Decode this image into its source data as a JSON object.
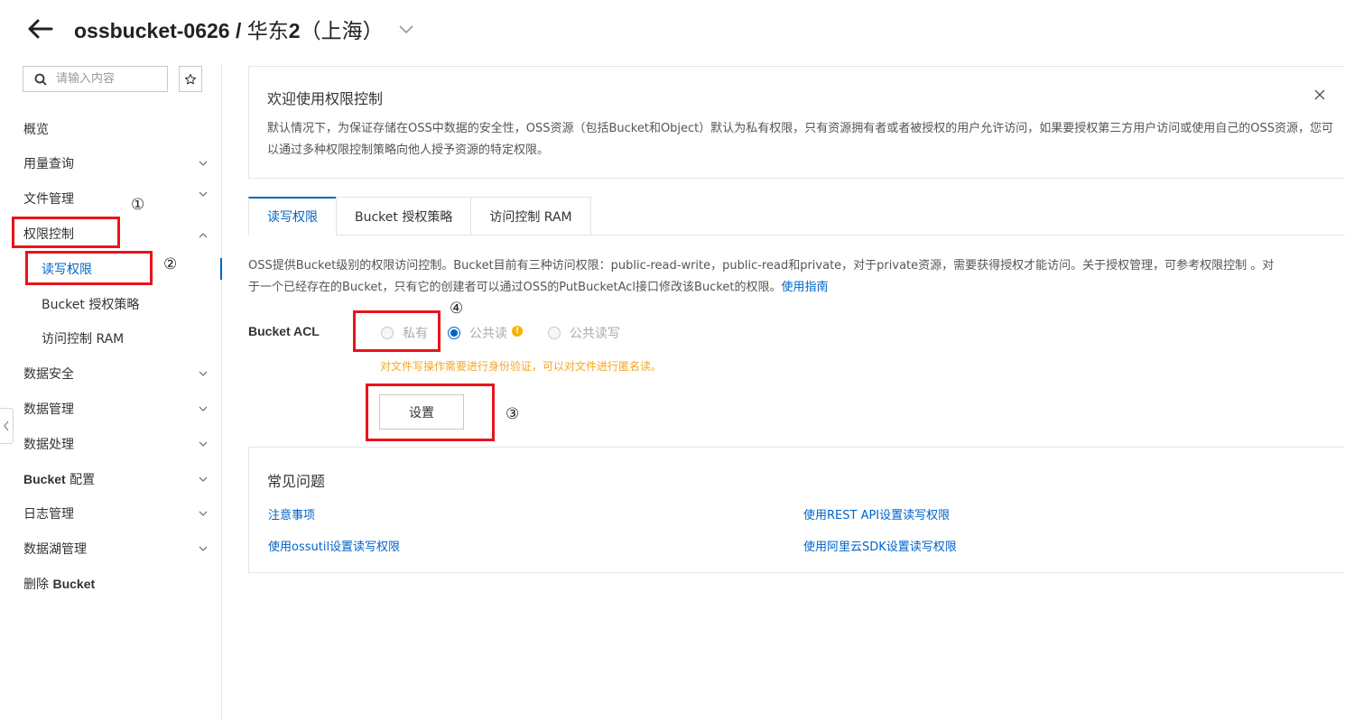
{
  "header": {
    "bucket_name": "ossbucket-0626",
    "separator": " / ",
    "region_prefix": "华东",
    "region_number": "2",
    "region_city": "（上海）"
  },
  "sidebar": {
    "search_placeholder": "请输入内容",
    "items": [
      {
        "label": "概览",
        "expandable": false
      },
      {
        "label": "用量查询",
        "expandable": true
      },
      {
        "label": "文件管理",
        "expandable": true
      },
      {
        "label": "权限控制",
        "expandable": true,
        "expanded": true
      },
      {
        "label": "读写权限",
        "sub": true,
        "active": true
      },
      {
        "label": "Bucket 授权策略",
        "sub": true
      },
      {
        "label": "访问控制 RAM",
        "sub": true
      },
      {
        "label": "数据安全",
        "expandable": true
      },
      {
        "label": "数据管理",
        "expandable": true
      },
      {
        "label": "数据处理",
        "expandable": true
      },
      {
        "label_bold": "Bucket",
        "label_rest": " 配置",
        "expandable": true
      },
      {
        "label": "日志管理",
        "expandable": true
      },
      {
        "label": "数据湖管理",
        "expandable": true
      },
      {
        "label_rest": "删除 ",
        "label_bold": "Bucket",
        "expandable": false
      }
    ]
  },
  "welcome": {
    "title": "欢迎使用权限控制",
    "description": "默认情况下，为保证存储在OSS中数据的安全性，OSS资源（包括Bucket和Object）默认为私有权限，只有资源拥有者或者被授权的用户允许访问，如果要授权第三方用户访问或使用自己的OSS资源，您可以通过多种权限控制策略向他人授予资源的特定权限。"
  },
  "tabs": [
    "读写权限",
    "Bucket 授权策略",
    "访问控制 RAM"
  ],
  "acl": {
    "desc_line1": "OSS提供Bucket级别的权限访问控制。Bucket目前有三种访问权限：public-read-write，public-read和private，对于private资源，需要获得授权才能访问。关于授权管理，可参考权限控制 。对",
    "desc_line2": "于一个已经存在的Bucket，只有它的创建者可以通过OSS的PutBucketAcl接口修改该Bucket的权限。",
    "guide_link": "使用指南",
    "label": "Bucket ACL",
    "options": [
      "私有",
      "公共读",
      "公共读写"
    ],
    "selected": "公共读",
    "warning_mark": "!",
    "warning": "对文件写操作需要进行身份验证，可以对文件进行匿名读。",
    "set_button": "设置"
  },
  "faq": {
    "title": "常见问题",
    "links": [
      "注意事项",
      "使用REST API设置读写权限",
      "使用ossutil设置读写权限",
      "使用阿里云SDK设置读写权限"
    ]
  },
  "annotations": [
    "①",
    "②",
    "③",
    "④"
  ],
  "colors": {
    "accent": "#0064c8",
    "warning": "#f5a623",
    "annotation": "#e8141b"
  }
}
